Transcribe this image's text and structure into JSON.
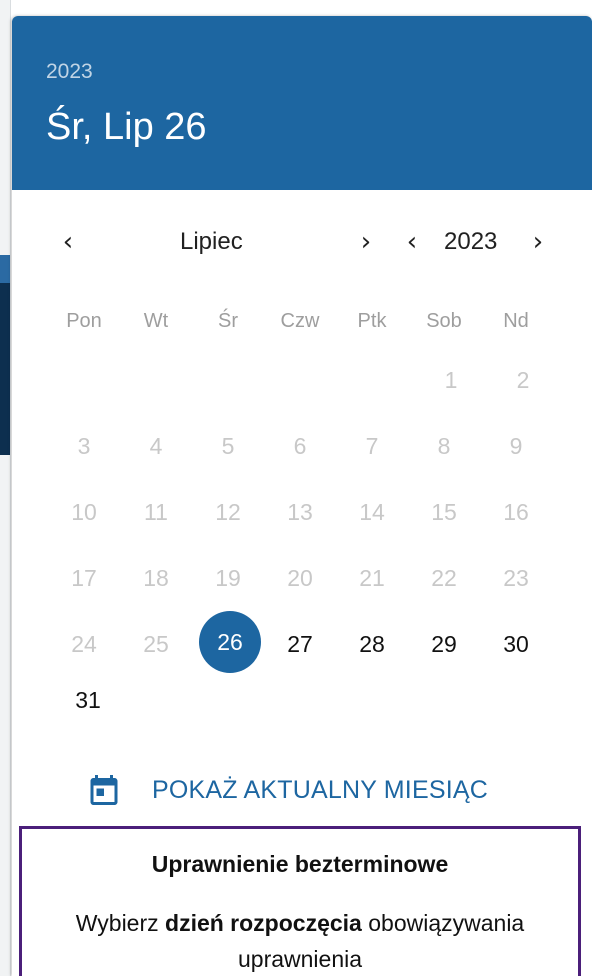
{
  "header": {
    "year": "2023",
    "date": "Śr, Lip 26",
    "background_color": "#1d66a1"
  },
  "navigation": {
    "prev_month_icon": "chevron-left-icon",
    "month": "Lipiec",
    "next_month_icon": "chevron-right-icon",
    "prev_year_icon": "chevron-left-icon",
    "year": "2023",
    "next_year_icon": "chevron-right-icon",
    "prev_symbol": "‹",
    "next_symbol": "›"
  },
  "weekdays": [
    "Pon",
    "Wt",
    "Śr",
    "Czw",
    "Ptk",
    "Sob",
    "Nd"
  ],
  "days": {
    "disabled": [
      "1",
      "2",
      "3",
      "4",
      "5",
      "6",
      "7",
      "8",
      "9",
      "10",
      "11",
      "12",
      "13",
      "14",
      "15",
      "16",
      "17",
      "18",
      "19",
      "20",
      "21",
      "22",
      "23",
      "24",
      "25"
    ],
    "selected": "26",
    "enabled": [
      "27",
      "28",
      "29",
      "30",
      "31"
    ]
  },
  "today_button": {
    "icon": "calendar-icon",
    "label": "POKAŻ AKTUALNY MIESIĄC"
  },
  "info": {
    "title": "Uprawnienie bezterminowe",
    "body_prefix": "Wybierz ",
    "body_bold": "dzień rozpoczęcia",
    "body_suffix": " obowiązywania uprawnienia",
    "border_color": "#4b1f7a"
  },
  "colors": {
    "accent": "#1d66a1",
    "disabled_day": "#c8c8c8",
    "weekday": "#9e9e9e"
  }
}
